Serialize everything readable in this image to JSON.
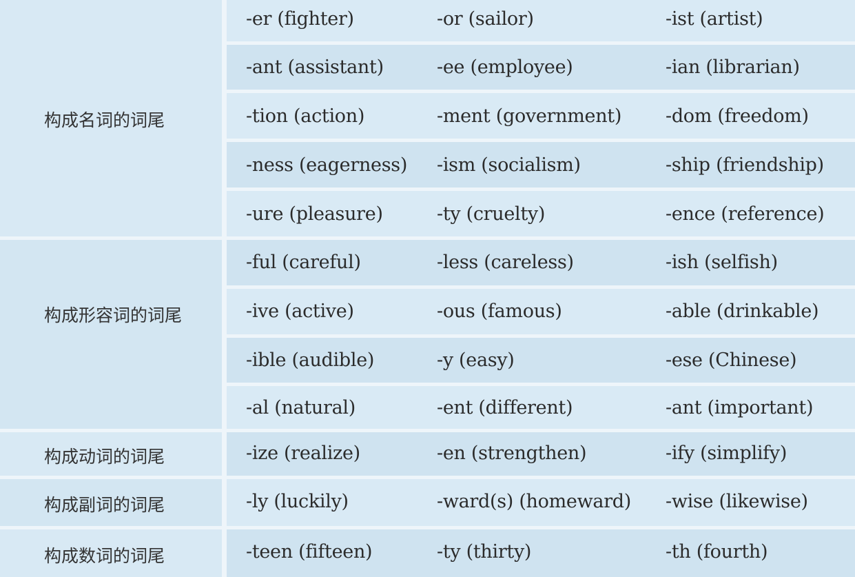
{
  "groups": [
    {
      "label": "构成名词的词尾",
      "rows": [
        [
          "-er (fighter)",
          "-or (sailor)",
          "-ist (artist)"
        ],
        [
          "-ant (assistant)",
          "-ee (employee)",
          "-ian (librarian)"
        ],
        [
          "-tion (action)",
          "-ment (government)",
          "-dom (freedom)"
        ],
        [
          "-ness (eagerness)",
          "-ism (socialism)",
          "-ship (friendship)"
        ],
        [
          "-ure (pleasure)",
          "-ty (cruelty)",
          "-ence (reference)"
        ]
      ]
    },
    {
      "label": "构成形容词的词尾",
      "rows": [
        [
          "-ful (careful)",
          "-less (careless)",
          "-ish (selfish)"
        ],
        [
          "-ive (active)",
          "-ous (famous)",
          "-able (drinkable)"
        ],
        [
          "-ible (audible)",
          "-y (easy)",
          "-ese (Chinese)"
        ],
        [
          "-al (natural)",
          "-ent (different)",
          "-ant (important)"
        ]
      ]
    },
    {
      "label": "构成动词的词尾",
      "rows": [
        [
          "-ize (realize)",
          "-en (strengthen)",
          "-ify (simplify)"
        ]
      ]
    },
    {
      "label": "构成副词的词尾",
      "rows": [
        [
          "-ly (luckily)",
          "-ward(s) (homeward)",
          "-wise (likewise)"
        ]
      ]
    },
    {
      "label": "构成数词的词尾",
      "rows": [
        [
          "-teen (fifteen)",
          "-ty (thirty)",
          "-th (fourth)"
        ]
      ]
    }
  ]
}
